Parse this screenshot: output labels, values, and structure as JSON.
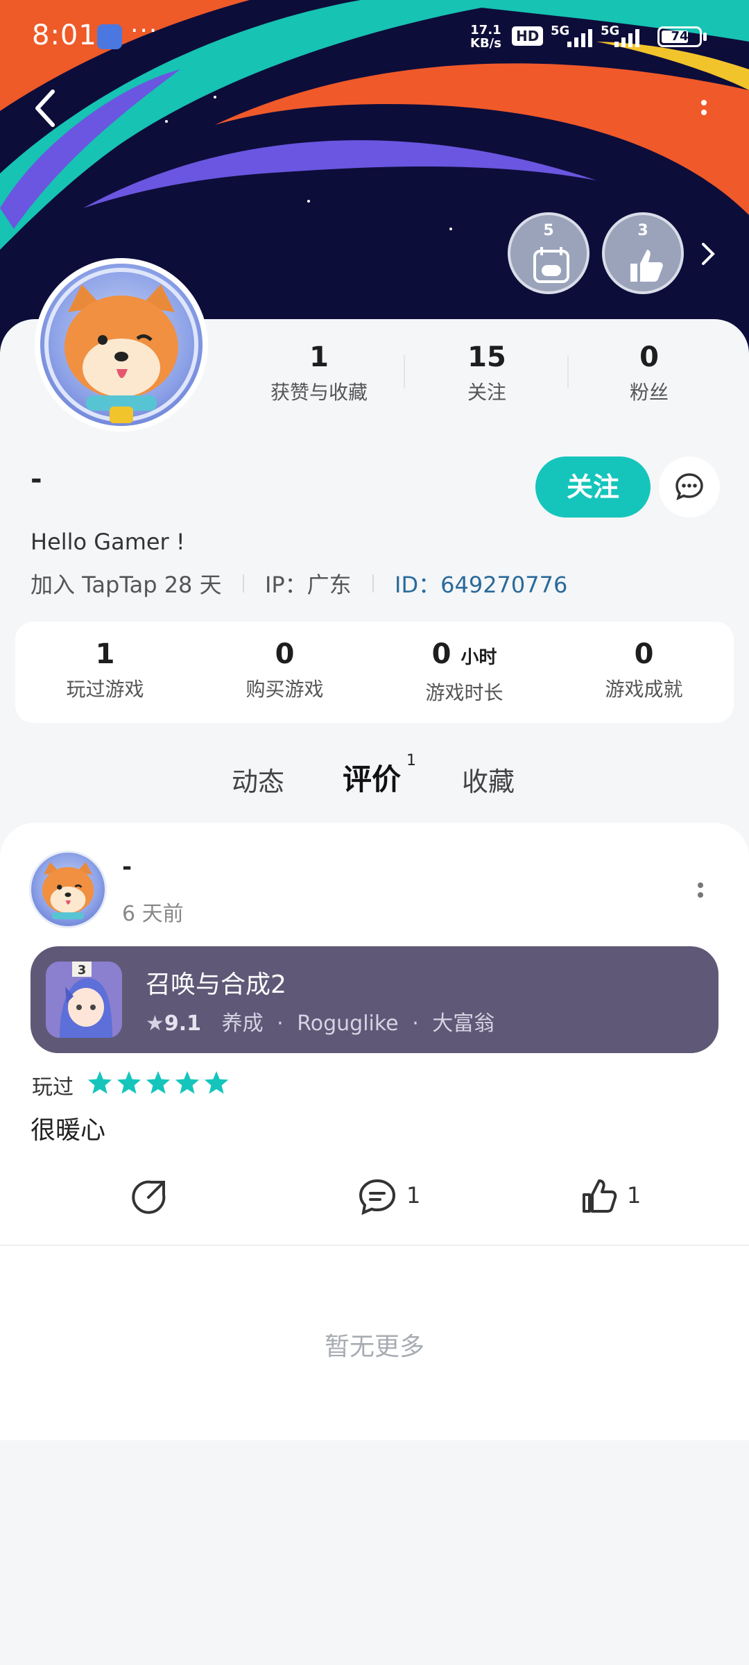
{
  "status_bar": {
    "time": "8:01",
    "dots": "···",
    "net_speed_top": "17.1",
    "net_speed_bottom": "KB/s",
    "hd": "HD",
    "net_type_1": "5G",
    "net_type_2": "5G",
    "battery": "74",
    "battery_level": 0.74
  },
  "badges": [
    {
      "count": "5",
      "icon": "gamepad-calendar-icon"
    },
    {
      "count": "3",
      "icon": "thumbs-up-icon"
    }
  ],
  "profile": {
    "likes_count": "1",
    "likes_label": "获赞与收藏",
    "following_count": "15",
    "following_label": "关注",
    "followers_count": "0",
    "followers_label": "粉丝",
    "username": "-",
    "follow_button": "关注",
    "bio": "Hello Gamer !",
    "joined": "加入 TapTap 28 天",
    "ip": "IP：广东",
    "id": "ID：649270776"
  },
  "game_stats": [
    {
      "value": "1",
      "unit": "",
      "label": "玩过游戏"
    },
    {
      "value": "0",
      "unit": "",
      "label": "购买游戏"
    },
    {
      "value": "0",
      "unit": "小时",
      "label": "游戏时长"
    },
    {
      "value": "0",
      "unit": "",
      "label": "游戏成就"
    }
  ],
  "tabs": [
    {
      "label": "动态",
      "active": false
    },
    {
      "label": "评价",
      "active": true,
      "count": "1"
    },
    {
      "label": "收藏",
      "active": false
    }
  ],
  "post": {
    "author": "-",
    "time": "6 天前",
    "game": {
      "title": "召唤与合成2",
      "score": "9.1",
      "tag1": "养成",
      "tag2": "Roguglike",
      "tag3": "大富翁",
      "separator": "·",
      "icon_label": "3"
    },
    "played_label": "玩过",
    "stars": 5,
    "text": "很暖心",
    "comment_count": "1",
    "like_count": "1"
  },
  "no_more": "暂无更多",
  "colors": {
    "accent": "#15c5bc",
    "game_card": "#5f5977",
    "id_link": "#2a6a9a"
  }
}
